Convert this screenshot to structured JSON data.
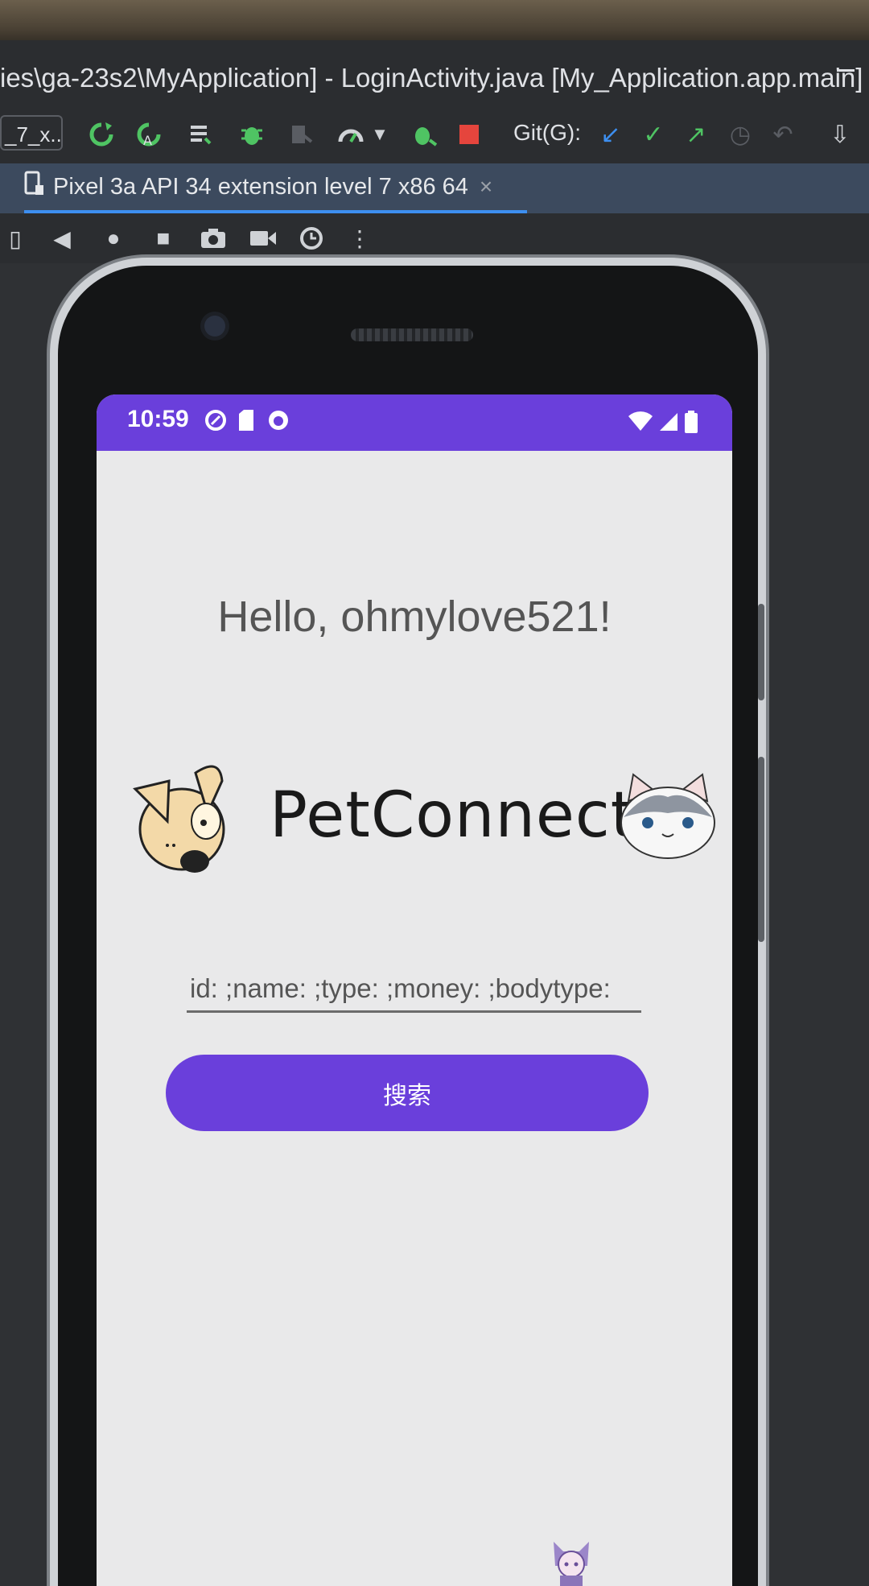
{
  "ide": {
    "window_title": "ies\\ga-23s2\\MyApplication] - LoginActivity.java [My_Application.app.main]",
    "run_config": "_7_x...",
    "git_label": "Git(G):",
    "device_tab_label": "Pixel 3a API 34 extension level 7 x86 64",
    "tab_close": "×"
  },
  "status_bar": {
    "time": "10:59"
  },
  "app": {
    "greeting": "Hello, ohmylove521!",
    "brand": "PetConnect",
    "search_placeholder": "id: ;name: ;type: ;money: ;bodytype:",
    "search_button": "搜索"
  },
  "colors": {
    "accent": "#6a3fdb",
    "screen_bg": "#e9e9ea",
    "ide_bg": "#2b2d30"
  }
}
